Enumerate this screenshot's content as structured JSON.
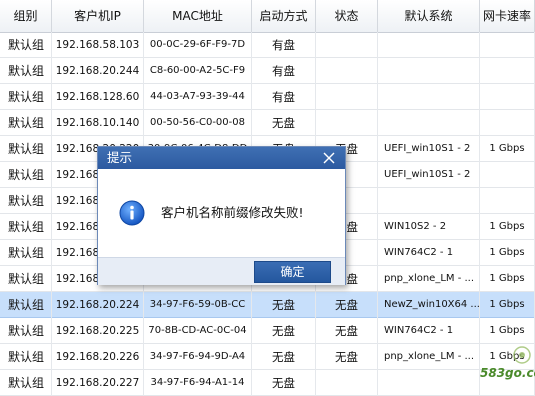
{
  "columns": [
    "组别",
    "客户机IP",
    "MAC地址",
    "启动方式",
    "状态",
    "默认系统",
    "网卡速率"
  ],
  "rows": [
    {
      "group": "默认组",
      "ip": "192.168.58.103",
      "mac": "00-0C-29-6F-F9-7D",
      "boot": "有盘",
      "status": "",
      "os": "",
      "speed": ""
    },
    {
      "group": "默认组",
      "ip": "192.168.20.244",
      "mac": "C8-60-00-A2-5C-F9",
      "boot": "有盘",
      "status": "",
      "os": "",
      "speed": ""
    },
    {
      "group": "默认组",
      "ip": "192.168.128.60",
      "mac": "44-03-A7-93-39-44",
      "boot": "有盘",
      "status": "",
      "os": "",
      "speed": ""
    },
    {
      "group": "默认组",
      "ip": "192.168.10.140",
      "mac": "00-50-56-C0-00-08",
      "boot": "无盘",
      "status": "",
      "os": "",
      "speed": ""
    },
    {
      "group": "默认组",
      "ip": "192.168.20.220",
      "mac": "30-9C-06-4C-D8-DD",
      "boot": "无盘",
      "status": "无盘",
      "os": "UEFI_win10S1 - 2",
      "speed": "1 Gbps"
    },
    {
      "group": "默认组",
      "ip": "192.168.20.221",
      "mac": "",
      "boot": "",
      "status": "",
      "os": "UEFI_win10S1 - 2",
      "speed": ""
    },
    {
      "group": "默认组",
      "ip": "192.168.20.222",
      "mac": "",
      "boot": "",
      "status": "",
      "os": "",
      "speed": ""
    },
    {
      "group": "默认组",
      "ip": "192.168.20.223",
      "mac": "",
      "boot": "",
      "status": "无盘",
      "os": "WIN10S2 - 2",
      "speed": "1 Gbps"
    },
    {
      "group": "默认组",
      "ip": "192.168.20.228",
      "mac": "",
      "boot": "",
      "status": "",
      "os": "WIN764C2 - 1",
      "speed": "1 Gbps"
    },
    {
      "group": "默认组",
      "ip": "192.168.20.229",
      "mac": "",
      "boot": "",
      "status": "无盘",
      "os": "pnp_xlone_LM - ...",
      "speed": "1 Gbps"
    },
    {
      "group": "默认组",
      "ip": "192.168.20.224",
      "mac": "34-97-F6-59-0B-CC",
      "boot": "无盘",
      "status": "无盘",
      "os": "NewZ_win10X64 ...",
      "speed": "1 Gbps"
    },
    {
      "group": "默认组",
      "ip": "192.168.20.225",
      "mac": "70-8B-CD-AC-0C-04",
      "boot": "无盘",
      "status": "无盘",
      "os": "WIN764C2 - 1",
      "speed": "1 Gbps"
    },
    {
      "group": "默认组",
      "ip": "192.168.20.226",
      "mac": "34-97-F6-94-9D-A4",
      "boot": "无盘",
      "status": "无盘",
      "os": "pnp_xlone_LM - ...",
      "speed": "1 Gbps"
    },
    {
      "group": "默认组",
      "ip": "192.168.20.227",
      "mac": "34-97-F6-94-A1-14",
      "boot": "无盘",
      "status": "",
      "os": "",
      "speed": ""
    }
  ],
  "selected_row_index": 10,
  "dialog": {
    "title": "提示",
    "message": "客户机名称前缀修改失败!",
    "ok_label": "确定",
    "icon": "info-icon",
    "close_icon": "close-icon"
  },
  "watermark": "583go.com",
  "colors": {
    "dialog_title_bg": "#2f5fa6",
    "selected_row_bg": "#c7dffb",
    "ok_button_bg": "#2b5ea5"
  }
}
